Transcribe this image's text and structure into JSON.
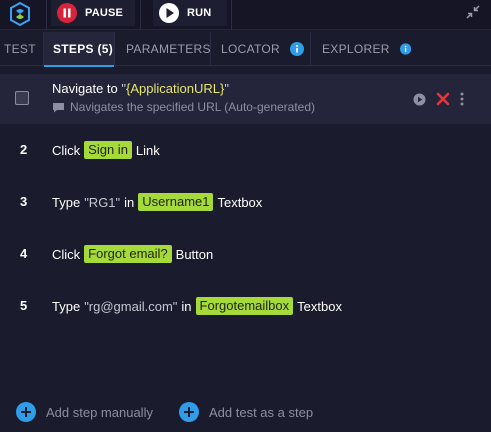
{
  "toolbar": {
    "pause_label": "PAUSE",
    "run_label": "RUN"
  },
  "tabs": [
    {
      "label": "TEST"
    },
    {
      "label": "STEPS (5)"
    },
    {
      "label": "PARAMETERS"
    },
    {
      "label": "LOCATOR"
    },
    {
      "label": "EXPLORER"
    }
  ],
  "steps": {
    "s1": {
      "prefix": "Navigate to",
      "quote_open": "\"",
      "param": "{ApplicationURL}",
      "quote_close": "\"",
      "description": "Navigates the specified URL (Auto-generated)"
    },
    "s2": {
      "num": "2",
      "action": "Click",
      "target": "Sign in",
      "suffix": "Link"
    },
    "s3": {
      "num": "3",
      "action": "Type",
      "value": "\"RG1\"",
      "connector": "in",
      "target": "Username1",
      "suffix": "Textbox"
    },
    "s4": {
      "num": "4",
      "action": "Click",
      "target": "Forgot email?",
      "suffix": "Button"
    },
    "s5": {
      "num": "5",
      "action": "Type",
      "value": "\"rg@gmail.com\"",
      "connector": "in",
      "target": "Forgotemailbox",
      "suffix": "Textbox"
    }
  },
  "footer": {
    "add_manual": "Add step manually",
    "add_test": "Add test as a step"
  },
  "colors": {
    "background": "#1b1b2e",
    "accent_blue": "#2f9de8",
    "chip_green": "#a6d93a",
    "delete_red": "#e8353b",
    "pause_red": "#d8243a"
  }
}
